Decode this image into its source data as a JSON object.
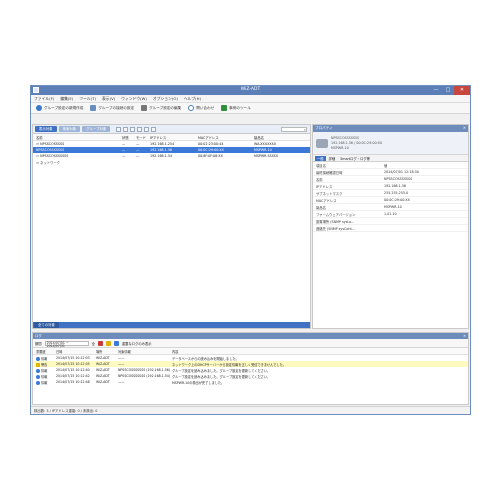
{
  "window": {
    "title": "WiZ-ADT"
  },
  "window_controls": {
    "minimize": "—",
    "maximize": "□",
    "close": "✕"
  },
  "menu": [
    "ファイル(F)",
    "編集(E)",
    "ツール(T)",
    "表示(V)",
    "ウィンドウ(W)",
    "オプション(O)",
    "ヘルプ(H)"
  ],
  "toolbar": [
    {
      "label": "グループ設定の新規作成",
      "icon": "blue-circle-icon"
    },
    {
      "label": "グループの接続の設定",
      "icon": "plus-icon"
    },
    {
      "label": "グループ設定の編集",
      "icon": "pencil-icon"
    },
    {
      "label": "問い合わせ",
      "icon": "help-icon"
    },
    {
      "label": "事例のツール",
      "icon": "green-box-icon"
    }
  ],
  "left": {
    "tabs": [
      "表示対象",
      "検索対象",
      "グループ対象"
    ],
    "columns": [
      "名前",
      "状態",
      "モード",
      "IPアドレス",
      "MACアドレス",
      "製品名"
    ],
    "rows": [
      {
        "name": "▭ NPSSCOSSSSS",
        "state": "—",
        "mode": "—",
        "ip": "192.168.1.254",
        "mac": "00:02:23:00:44",
        "product": "WA-XXXXXXX",
        "selected": false
      },
      {
        "name": "  NPSSCOSSSSSSS",
        "state": "—",
        "mode": "—",
        "ip": "192.168.1.56",
        "mac": "00:0C:29:00:XX",
        "product": "MSPWR-10",
        "selected": true
      },
      {
        "name": "  ▭ NPSSCOSSSSSSS",
        "state": "—",
        "mode": "—",
        "ip": "192.168.1.54",
        "mac": "00:8F:0F:08:XX",
        "product": "MSPWR-SSSSS",
        "selected": false
      },
      {
        "name": "▭ ネットワーク",
        "state": "",
        "mode": "",
        "ip": "",
        "mac": "",
        "product": "",
        "selected": false
      }
    ],
    "bottom_tab": "全ての対象"
  },
  "right": {
    "title": "プロパティ",
    "header_lines": [
      "NPSSCOSSSSSSS",
      "192.168.1.56 / 00:0C:29:00:XX",
      "MSPWR-10"
    ],
    "tabs": [
      "一般",
      "詳細",
      "Smartログ・ログ等"
    ],
    "props": [
      {
        "k": "項目名",
        "v": "値"
      },
      {
        "k": "最終接続確認日時",
        "v": "2014/07/01 12:18:30"
      },
      {
        "k": "名前",
        "v": "NPSSCOSSSSSSS"
      },
      {
        "k": "IPアドレス",
        "v": "192.168.1.56"
      },
      {
        "k": "サブネットマスク",
        "v": "255.255.255.0"
      },
      {
        "k": "MACアドレス",
        "v": "00:0C:29:00:XX"
      },
      {
        "k": "製品名",
        "v": "MSPWR-10"
      },
      {
        "k": "ファームウェアバージョン",
        "v": "1.01.10"
      },
      {
        "k": "設置場所 (SNMP sysLo...",
        "v": ""
      },
      {
        "k": "連絡先 (SNMP sysCont...",
        "v": ""
      }
    ]
  },
  "log": {
    "title": "ログ",
    "toolbar_label": "期間",
    "date_range": "2014/07/01 ~ 2014/07/31",
    "count_label": "全",
    "filter_label": "重要なログのみ表示",
    "columns": [
      "重要度",
      "日時",
      "場所",
      "対象情報",
      "内容"
    ],
    "rows": [
      {
        "sev": "info",
        "sevtext": "情報",
        "date": "2014/07/15 10:12:03",
        "place": "WiZ-ADT",
        "target": "——",
        "content": "データベースからの読み込みを開始しました。"
      },
      {
        "sev": "warning",
        "sevtext": "警告",
        "date": "2014/07/15 10:12:05",
        "place": "WiZ-ADT",
        "target": "——",
        "content": "ネットワーク上のDHCPサーバーから設定情報を正しく受信できませんでした。"
      },
      {
        "sev": "info",
        "sevtext": "情報",
        "date": "2014/07/15 10:12:40",
        "place": "WiZ-ADT",
        "target": "NPSSCOSSSSSSS (192.168.1.56)",
        "content": "グループ設定を読み込みました。グループ設定を更新してください。"
      },
      {
        "sev": "info",
        "sevtext": "情報",
        "date": "2014/07/15 10:12:42",
        "place": "WiZ-ADT",
        "target": "NPSSCOSSSSSSS (192.168.1.54)",
        "content": "グループ設定を読み込みました。グループ設定を更新してください。"
      },
      {
        "sev": "info",
        "sevtext": "情報",
        "date": "2014/07/15 10:12:48",
        "place": "WiZ-ADT",
        "target": "——",
        "content": "MSPWR-10の検出が完了しました。"
      }
    ]
  },
  "status": {
    "text": "検出数: 3 / IPアドレス重複: 0 / 未検出: 0"
  }
}
